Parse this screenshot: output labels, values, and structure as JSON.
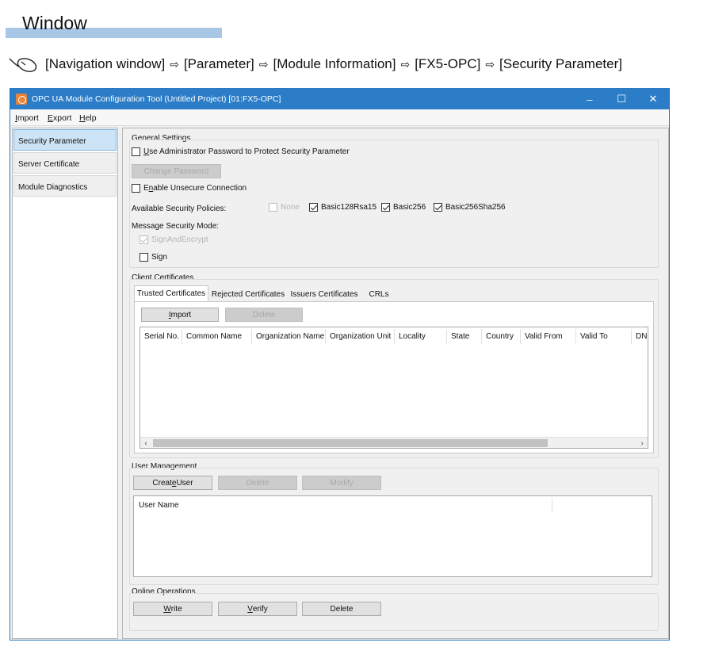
{
  "doc": {
    "heading": "Window",
    "nav_path": [
      "[Navigation window]",
      "[Parameter]",
      "[Module Information]",
      "[FX5-OPC]",
      "[Security Parameter]"
    ],
    "arrow": "⇨"
  },
  "window": {
    "title": "OPC UA Module Configuration Tool (Untitled Project) [01:FX5-OPC]",
    "controls": {
      "minimize": "–",
      "maximize": "☐",
      "close": "✕"
    },
    "title_bar_color": "#2b7dc7"
  },
  "menu": {
    "import_u": "I",
    "import_rest": "mport",
    "export_u": "E",
    "export_rest": "xport",
    "help_u": "H",
    "help_rest": "elp"
  },
  "sidebar": {
    "items": [
      {
        "label": "Security Parameter",
        "selected": true
      },
      {
        "label": "Server Certificate",
        "selected": false
      },
      {
        "label": "Module Diagnostics",
        "selected": false
      }
    ]
  },
  "general": {
    "label": "General Settings",
    "use_admin_pw_u": "U",
    "use_admin_pw_rest": "se Administrator Password to Protect Security Parameter",
    "use_admin_pw_checked": false,
    "change_password_button": "Change Password",
    "enable_unsecure_pre": "E",
    "enable_unsecure_u": "n",
    "enable_unsecure_rest": "able Unsecure Connection",
    "enable_unsecure_checked": false,
    "policies_label": "Available Security Policies:",
    "policies": [
      {
        "label": "None",
        "checked": false,
        "disabled": true
      },
      {
        "label": "Basic128Rsa15",
        "checked": true,
        "disabled": false
      },
      {
        "label": "Basic256",
        "checked": true,
        "disabled": false
      },
      {
        "label": "Basic256Sha256",
        "checked": true,
        "disabled": false
      }
    ],
    "msg_mode_label": "Message Security Mode:",
    "msg_modes": [
      {
        "label": "SignAndEncrypt",
        "checked": true,
        "disabled": true
      },
      {
        "label": "Sign",
        "checked": false,
        "disabled": false
      }
    ]
  },
  "client_certs": {
    "label": "Client Certificates",
    "tabs": [
      "Trusted Certificates",
      "Rejected Certificates",
      "Issuers Certificates",
      "CRLs"
    ],
    "import_u": "I",
    "import_rest": "mport",
    "delete_button": "Delete",
    "columns": [
      "Serial No.",
      "Common Name",
      "Organization Name",
      "Organization Unit",
      "Locality",
      "State",
      "Country",
      "Valid From",
      "Valid To",
      "DN"
    ],
    "scroll_left": "‹",
    "scroll_right": "›"
  },
  "user_mgmt": {
    "label": "User Management",
    "create_pre": "Creat",
    "create_u": "e",
    "create_rest": " User",
    "delete_button": "Delete",
    "modify_button": "Modify",
    "columns": [
      "User Name"
    ]
  },
  "online": {
    "label": "Online Operations",
    "write_u": "W",
    "write_rest": "rite",
    "verify_u": "V",
    "verify_rest": "erify",
    "delete_button": "Delete"
  }
}
